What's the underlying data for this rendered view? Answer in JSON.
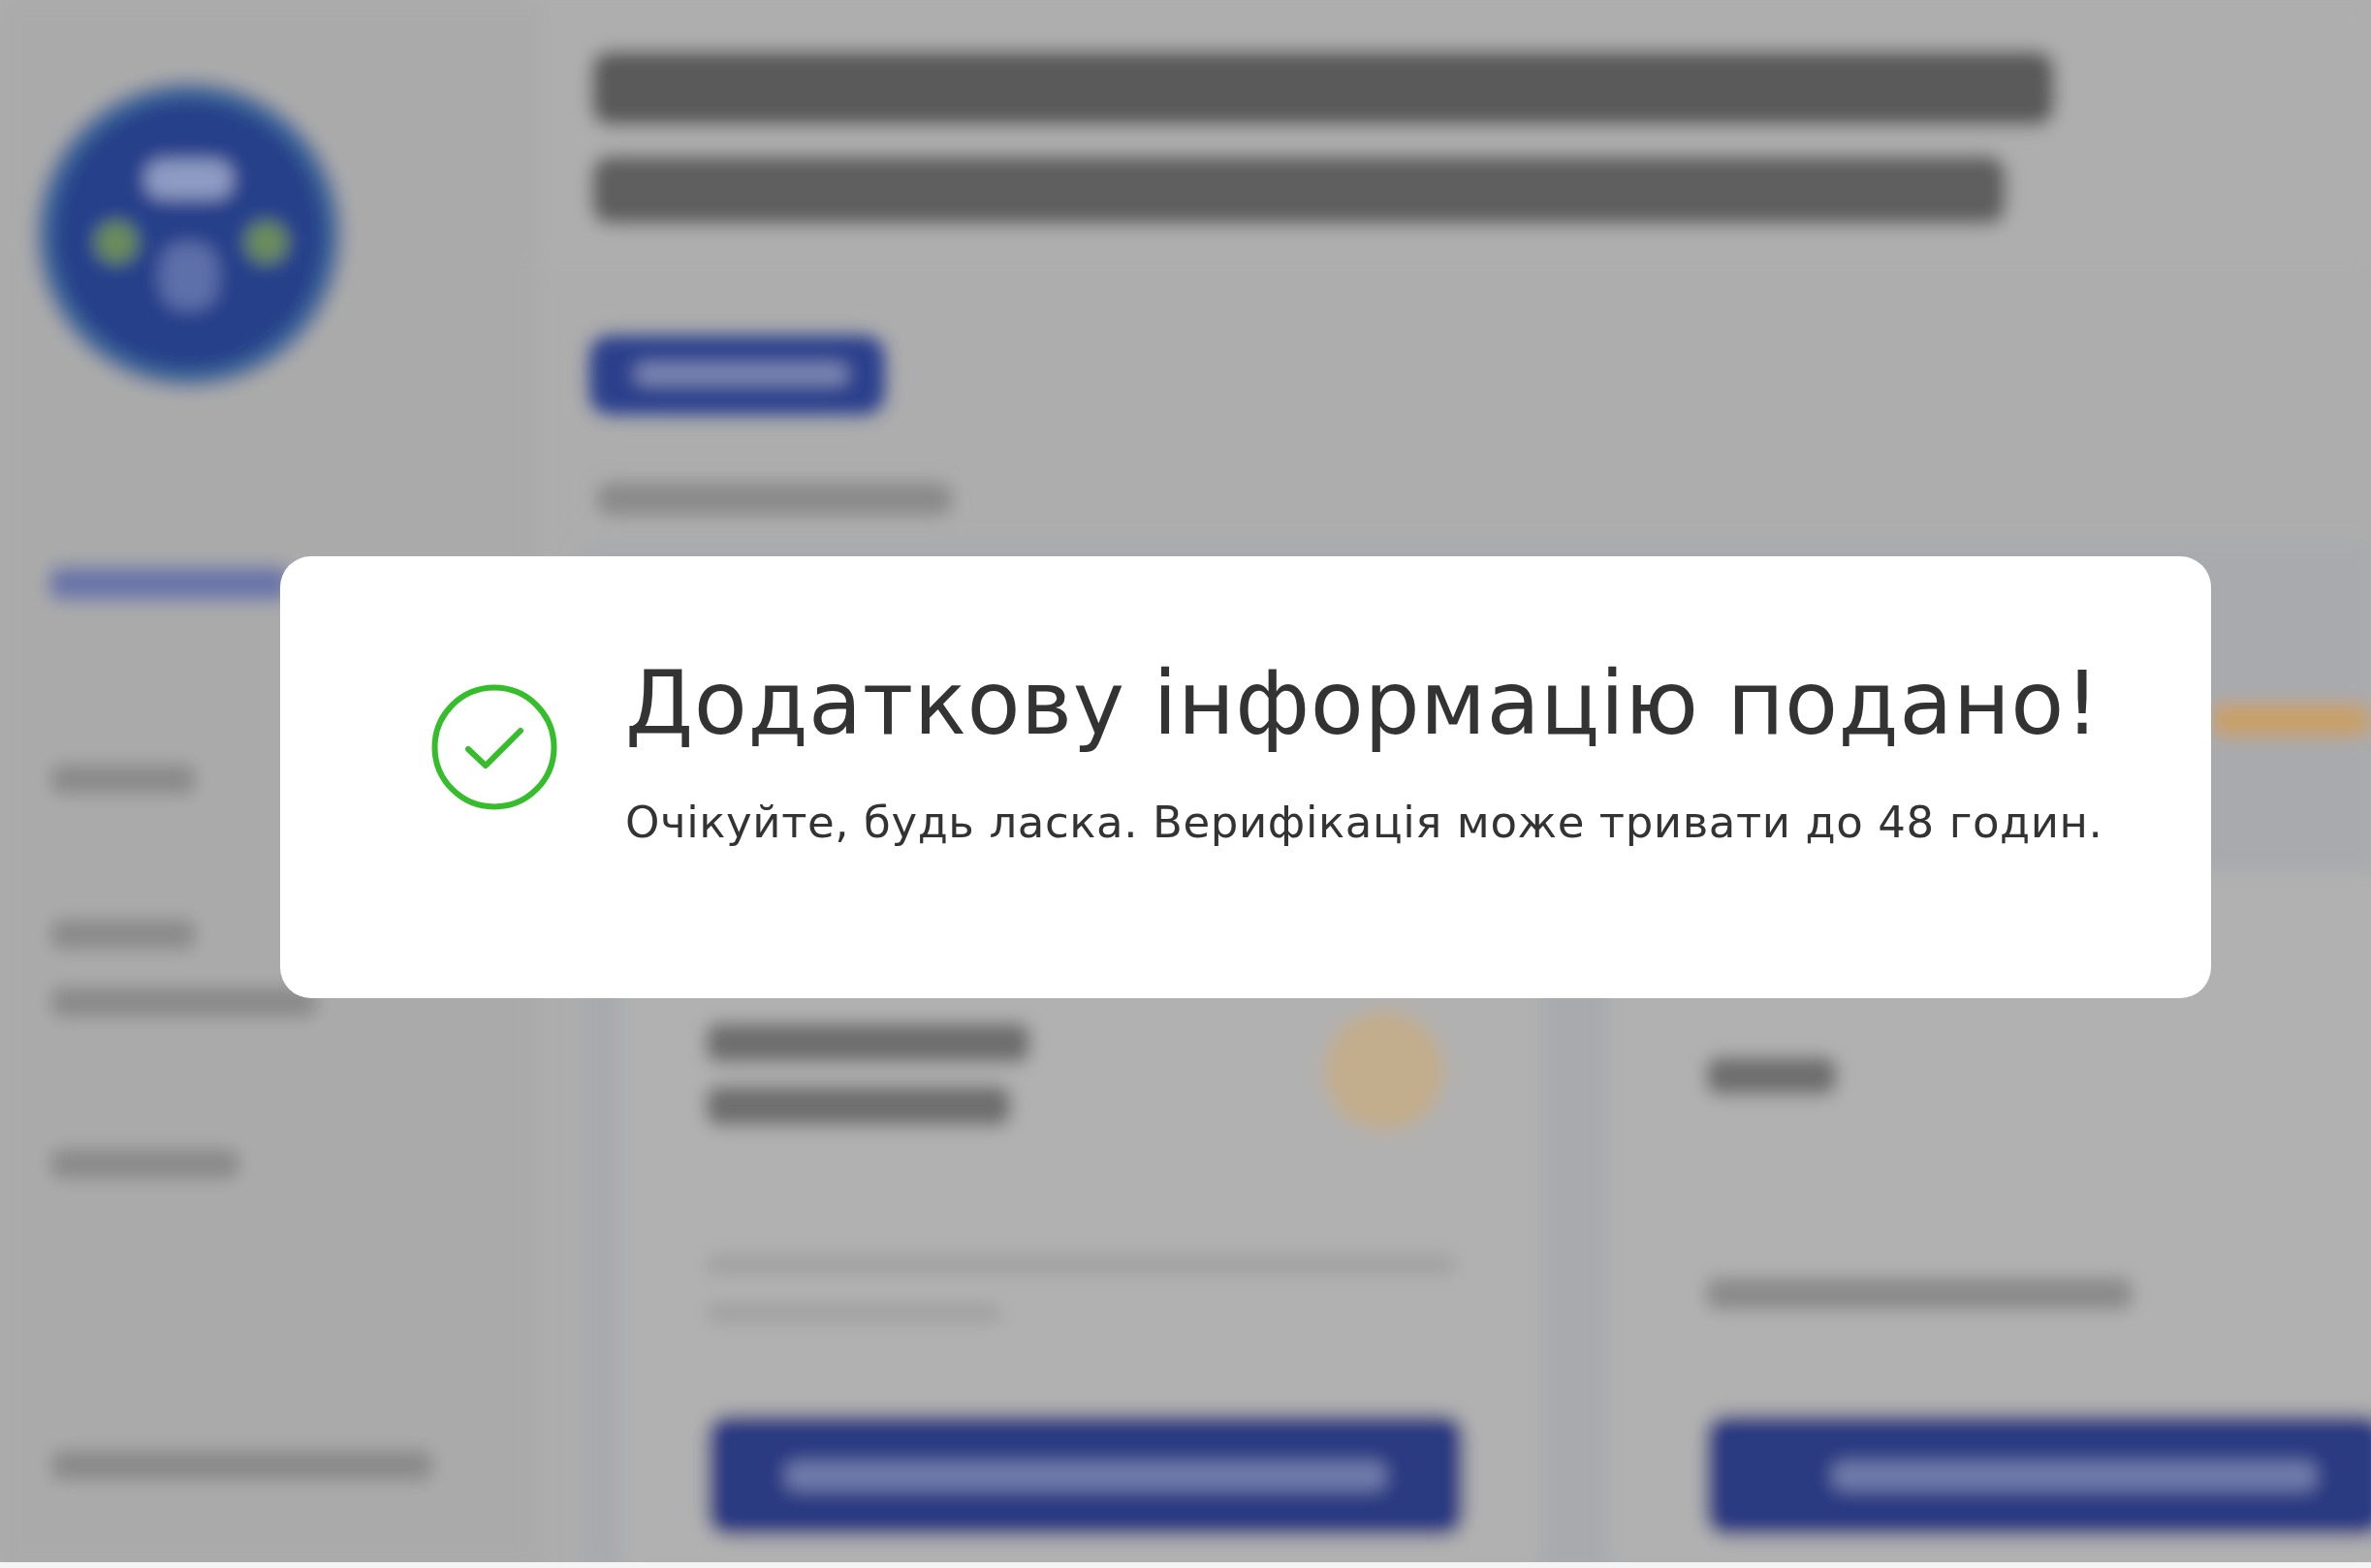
{
  "dialog": {
    "kind": "success",
    "title": "Додаткову інформацію подано!",
    "message": "Очікуйте, будь ласка. Верифікація може тривати до 48 годин."
  }
}
